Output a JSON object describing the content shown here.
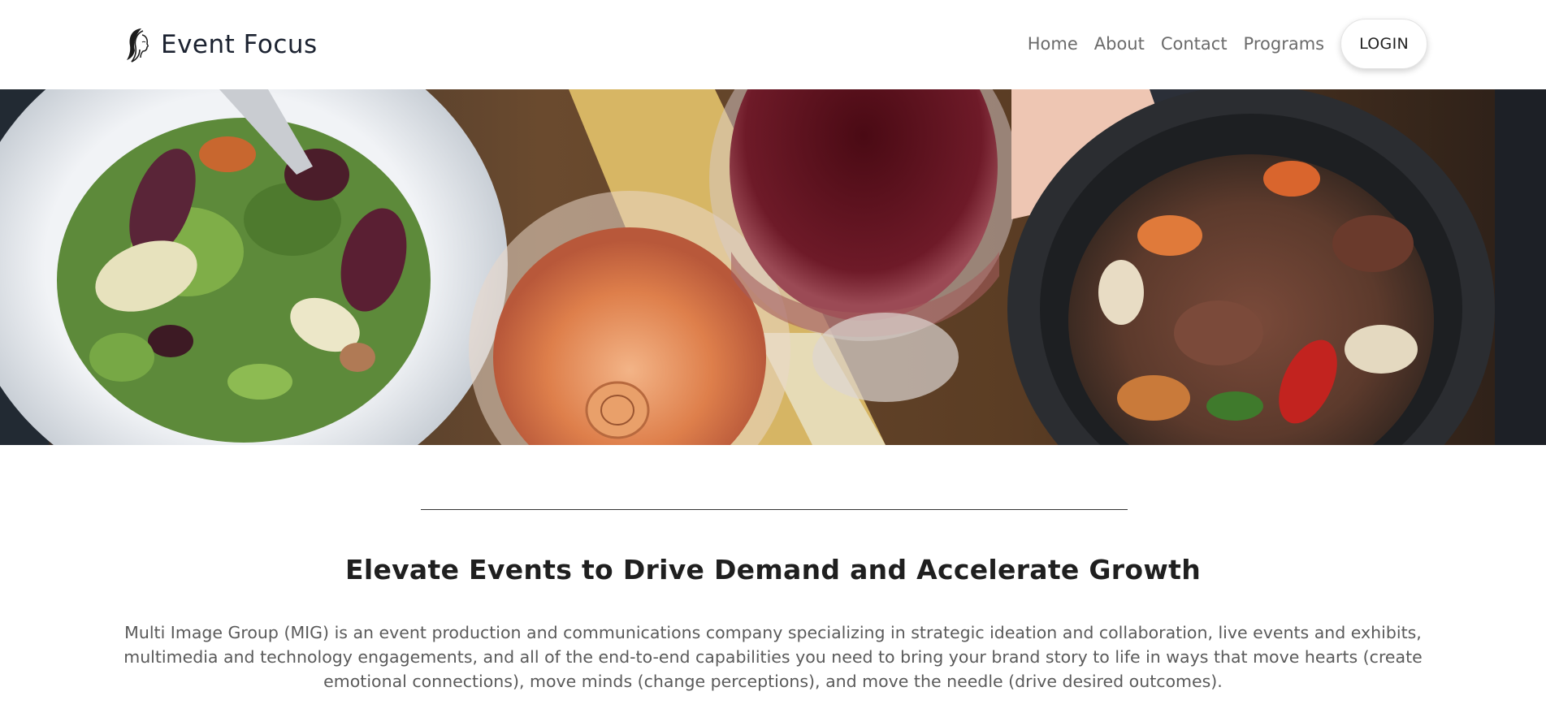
{
  "brand": {
    "name": "Event Focus",
    "logo_icon": "woman-profile-icon"
  },
  "nav": {
    "items": [
      {
        "label": "Home"
      },
      {
        "label": "About"
      },
      {
        "label": "Contact"
      },
      {
        "label": "Programs"
      }
    ],
    "login_label": "LOGIN"
  },
  "hero": {
    "image": "food-and-wine-toast-photo"
  },
  "main": {
    "headline": "Elevate Events to Drive Demand and Accelerate Growth",
    "intro": "Multi Image Group (MIG) is an event production and communications company specializing in strategic ideation and collaboration, live events and exhibits, multimedia and technology engagements, and all of the end-to-end capabilities you need to bring your brand story to life in ways that move hearts (create emotional connections), move minds (change perceptions), and move the needle (drive desired outcomes)."
  },
  "colors": {
    "brand_text": "#1b2230",
    "nav_text": "#6b6b6b",
    "body_text": "#5a5a5a"
  }
}
